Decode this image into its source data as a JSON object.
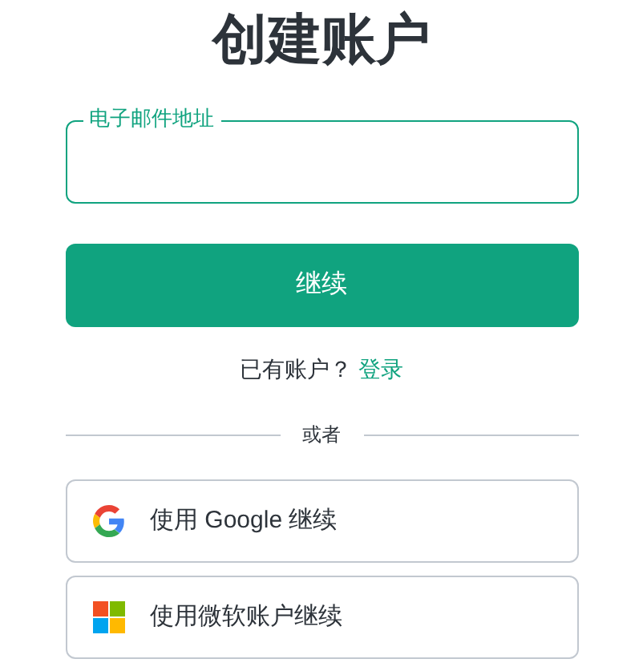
{
  "title": "创建账户",
  "email_field": {
    "label": "电子邮件地址"
  },
  "continue_button": "继续",
  "login_prompt": {
    "text": "已有账户？",
    "link": "登录"
  },
  "divider_text": "或者",
  "social_buttons": [
    {
      "kind": "google",
      "label": "使用 Google 继续"
    },
    {
      "kind": "microsoft",
      "label": "使用微软账户继续"
    }
  ]
}
